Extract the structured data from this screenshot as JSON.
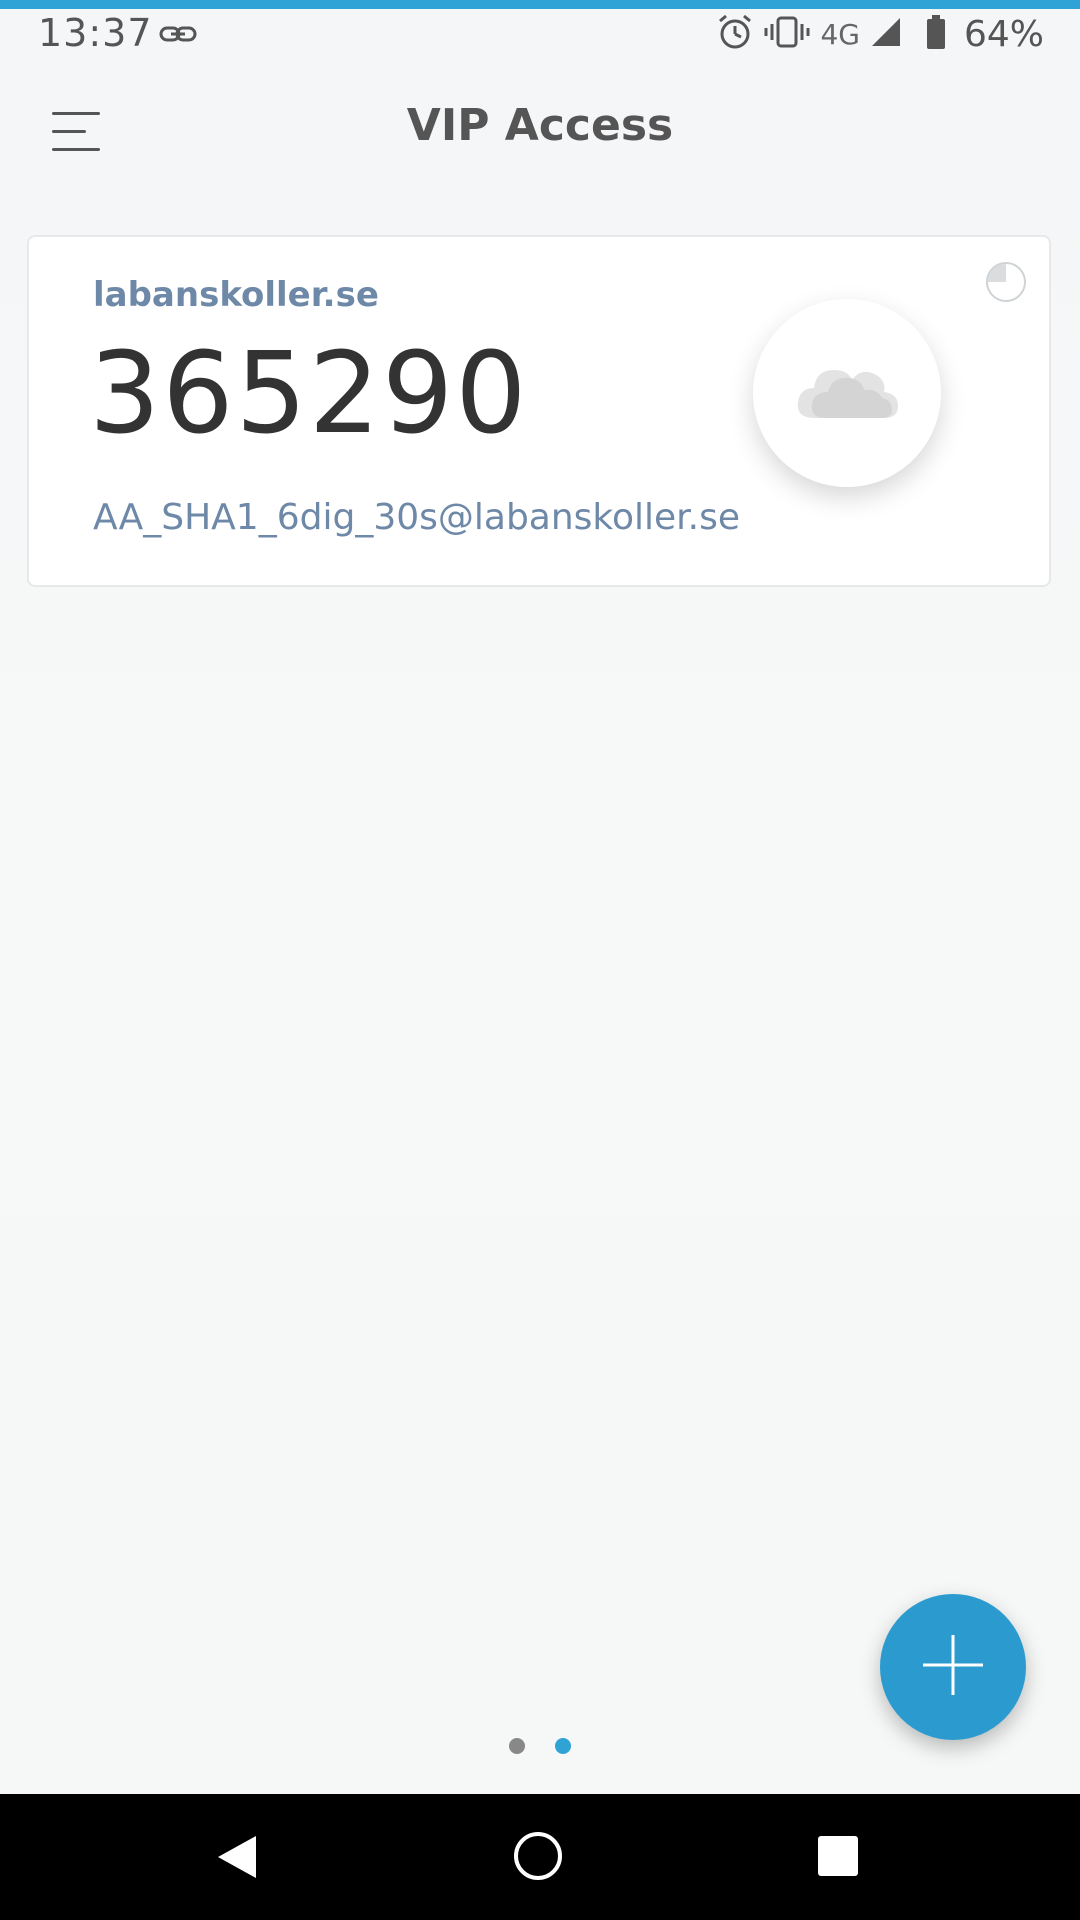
{
  "status_bar": {
    "time": "13:37",
    "network": "4G",
    "battery": "64%",
    "icons": [
      "link-icon",
      "alarm-icon",
      "vibrate-icon",
      "signal-icon",
      "battery-icon"
    ]
  },
  "app_bar": {
    "title": "VIP Access",
    "menu_icon": "hamburger-menu-icon"
  },
  "credential_card": {
    "issuer": "labanskoller.se",
    "code": "365290",
    "account": "AA_SHA1_6dig_30s@labanskoller.se",
    "sync_icon": "cloud-icon",
    "timer_icon": "countdown-pie-icon",
    "timer_remaining_fraction": 0.75
  },
  "pager": {
    "page_count": 2,
    "active_page": 2
  },
  "fab": {
    "icon": "plus-icon"
  },
  "nav_bar": {
    "icons": [
      "back-icon",
      "home-icon",
      "recents-icon"
    ]
  },
  "colors": {
    "accent": "#2fa3d6",
    "fab": "#2b9bcf",
    "card_text_secondary": "#6e88a8",
    "code_text": "#333333"
  }
}
